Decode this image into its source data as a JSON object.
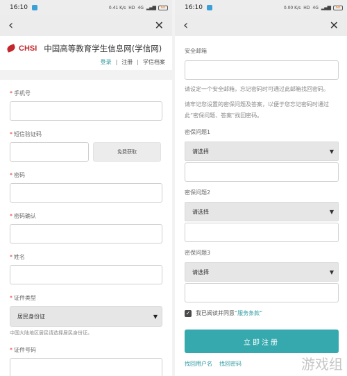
{
  "status_bar": {
    "time": "16:10",
    "network": "0.41 K/s",
    "hd": "HD",
    "signal": "4G",
    "battery": "68"
  },
  "status_bar_right": {
    "time": "16:10",
    "network": "0.00 K/s",
    "hd": "HD",
    "signal": "4G",
    "battery": "68"
  },
  "nav": {
    "back_glyph": "‹",
    "close_glyph": "✕"
  },
  "brand": {
    "logo_text": "CHSI",
    "title": "中国高等教育学生信息网(学信网)"
  },
  "top_links": {
    "login": "登录",
    "register": "注册",
    "find_admin": "学信档案"
  },
  "form_left": {
    "phone_label": "手机号",
    "code_label": "短信验证码",
    "get_code_button": "免费获取",
    "password_label": "密码",
    "confirm_label": "密码确认",
    "name_label": "姓名",
    "id_type_label": "证件类型",
    "id_type_value": "居民身份证",
    "id_type_hint": "中国大陆地区居民请选择居民身份证。",
    "id_number_label": "证件号码"
  },
  "form_right": {
    "email_label": "安全邮箱",
    "email_hint": "请设定一个安全邮箱，忘记密码时可通过此邮箱找回密码。",
    "question_hint": "请牢记您设置的密保问题及答案，以便于您忘记密码时通过此“密保问题、答案”找回密码。",
    "q1_label": "密保问题1",
    "q1_value": "请选择",
    "q2_label": "密保问题2",
    "q2_value": "请选择",
    "q3_label": "密保问题3",
    "q3_value": "请选择",
    "agree_prefix": "我已阅读并同意",
    "agree_link": "“服务条款”",
    "register_button": "立即注册",
    "find_username": "找回用户名",
    "find_password": "找回密码",
    "edge_char": "答"
  },
  "watermark": "游戏组",
  "colors": {
    "accent": "#35a9ad",
    "logo_red": "#c2272d",
    "bar": "#ececec"
  },
  "icons": {
    "back": "chevron-left-icon",
    "close": "close-icon",
    "caret": "caret-down-icon",
    "check": "checkbox-checked-icon"
  }
}
